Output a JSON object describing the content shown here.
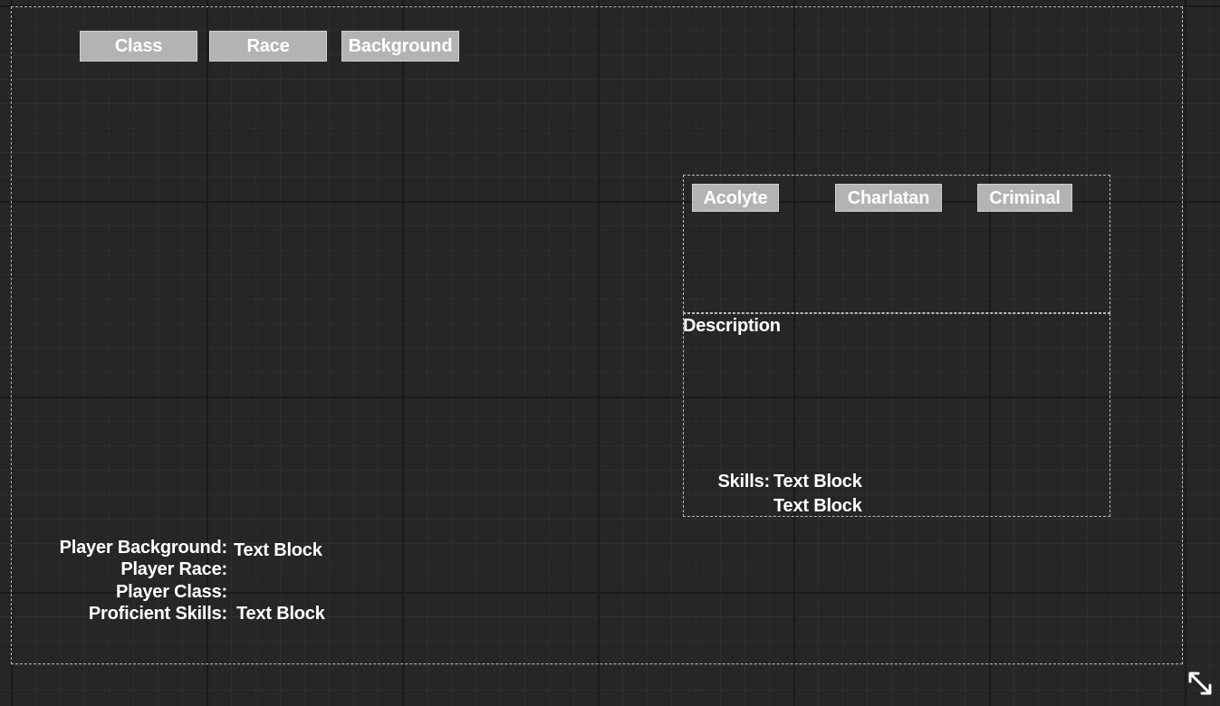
{
  "tabs": {
    "class_label": "Class",
    "race_label": "Race",
    "background_label": "Background"
  },
  "background_options": {
    "acolyte_label": "Acolyte",
    "charlatan_label": "Charlatan",
    "criminal_label": "Criminal"
  },
  "details": {
    "description_label": "Description",
    "skills_label": "Skills:",
    "skills_value_1": "Text Block",
    "skills_value_2": "Text Block"
  },
  "summary": {
    "background_label": "Player Background:",
    "background_value": "Text Block",
    "race_label": "Player Race:",
    "class_label": "Player Class:",
    "skills_label": "Proficient Skills:",
    "skills_value": "Text Block"
  },
  "colors": {
    "canvas_background": "#262626",
    "button_fill": "#b3b3b3",
    "text": "#ffffff",
    "dashed_outline": "#bdbdbd"
  },
  "icons": {
    "resize_handle": "expand-arrows-icon"
  }
}
